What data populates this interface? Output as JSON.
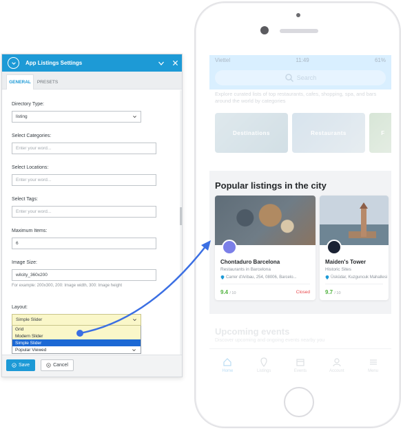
{
  "panel": {
    "title": "App Listings Settings",
    "tabs": [
      "GENERAL",
      "PRESETS"
    ],
    "directory_type": {
      "label": "Directory Type:",
      "value": "listing"
    },
    "categories": {
      "label": "Select Categories:",
      "placeholder": "Enter your word..."
    },
    "locations": {
      "label": "Select Locations:",
      "placeholder": "Enter your word..."
    },
    "tags": {
      "label": "Select Tags:",
      "placeholder": "Enter your word..."
    },
    "max_items": {
      "label": "Maximum Items:",
      "value": "6"
    },
    "image_size": {
      "label": "Image Size:",
      "value": "wilcity_360x200",
      "help": "For example: 200x300, 200: Image width, 300: Image height"
    },
    "layout": {
      "label": "Layout:",
      "value": "Simple Slider",
      "options": [
        "Grid",
        "Modern Slider",
        "Simple Slider",
        "Popular Viewed"
      ],
      "highlighted": "Simple Slider"
    },
    "save_label": "Save",
    "cancel_label": "Cancel",
    "accent": "#1d9ad6"
  },
  "phone": {
    "status": {
      "carrier": "Viettel",
      "time": "11:49",
      "battery": "61%"
    },
    "search_placeholder": "Search",
    "intro": "Explore curated lists of top restaurants, cafes, shopping, spa, and bars around the world by categories",
    "categories": [
      "Destinations",
      "Restaurants",
      "F"
    ],
    "popular_title": "Popular listings in the city",
    "listings": [
      {
        "name": "Chontaduro Barcelona",
        "subtitle": "Restaurants in Barcelona",
        "address": "Carrer d'Aribau, 254, 08006, Barcelo...",
        "score": "9.4",
        "score_max": "/ 10",
        "status": "Closed"
      },
      {
        "name": "Maiden's Tower",
        "subtitle": "Historic Sites",
        "address": "Üsküdar, Kuzguncuk Mahallesi",
        "score": "9.7",
        "score_max": "/ 10",
        "status": ""
      }
    ],
    "upcoming_title": "Upcoming events",
    "upcoming_sub": "Discover upcoming and ongoing events nearby you",
    "tabbar": [
      "Home",
      "Listings",
      "Events",
      "Account",
      "Menu"
    ]
  }
}
